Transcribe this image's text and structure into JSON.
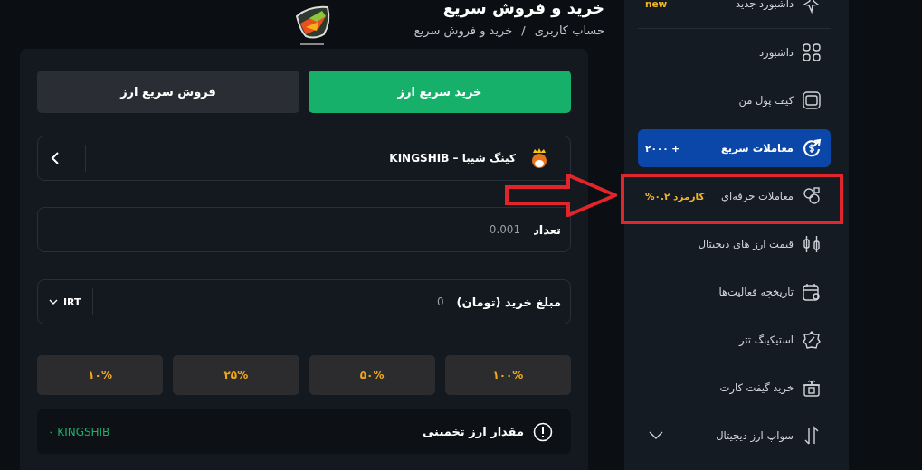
{
  "header": {
    "title": "خرید و فروش سریع",
    "breadcrumb_separator": "/",
    "breadcrumb": [
      {
        "label": "حساب کاربری"
      },
      {
        "label": "خرید و فروش سریع"
      }
    ]
  },
  "sidebar": {
    "items": [
      {
        "label": "داشبورد جدید",
        "selected": false,
        "badge": "new"
      },
      {
        "label": "داشبورد",
        "selected": false
      },
      {
        "label": "کیف پول من",
        "selected": false
      },
      {
        "label": "معاملات سریع",
        "selected": true,
        "badge": "+ ۲۰۰۰"
      },
      {
        "label": "معاملات حرفه‌ای",
        "selected": false,
        "badge": "کارمزد ۰.۲%"
      },
      {
        "label": "قیمت ارز های دیجیتال",
        "selected": false
      },
      {
        "label": "تاریخچه فعالیت‌ها",
        "selected": false
      },
      {
        "label": "استیکینگ تتر",
        "selected": false
      },
      {
        "label": "خرید گیفت کارت",
        "selected": false
      },
      {
        "label": "سواپ ارز دیجیتال",
        "selected": false,
        "expanded": false
      }
    ]
  },
  "trade": {
    "tabs": [
      {
        "label": "خرید سریع ارز",
        "selected": true
      },
      {
        "label": "فروش سریع ارز",
        "selected": false
      }
    ],
    "coin": {
      "name": "کینگ شیبا – KINGSHIB"
    },
    "quantity": {
      "label": "تعداد",
      "placeholder": "0.001"
    },
    "amount": {
      "label": "مبلغ خرید (تومان)",
      "placeholder": "0",
      "currency": "IRT"
    },
    "percent_buttons": [
      "۱۰۰%",
      "۵۰%",
      "۲۵%",
      "۱۰%"
    ],
    "estimate": {
      "label": "مقدار ارز تخمینی",
      "value": "۰ KINGSHIB"
    }
  }
}
